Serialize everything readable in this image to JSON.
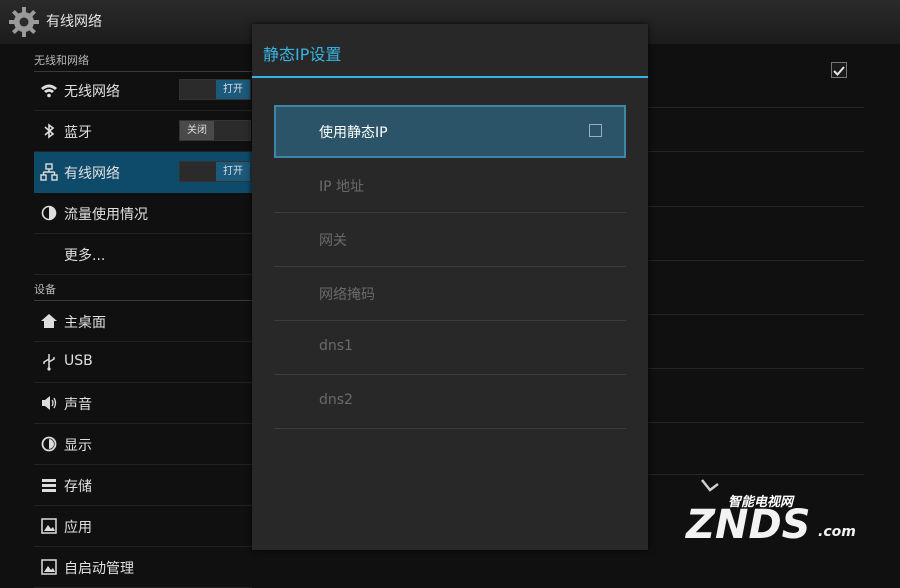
{
  "actionbar": {
    "title": "有线网络",
    "icon": "gear-icon"
  },
  "sections": [
    {
      "label": "无线和网络"
    },
    {
      "label": "设备"
    }
  ],
  "menu": [
    {
      "label": "无线网络",
      "icon": "wifi-icon",
      "toggle": "打开",
      "toggle_state": "on"
    },
    {
      "label": "蓝牙",
      "icon": "bluetooth-icon",
      "toggle": "关闭",
      "toggle_state": "off"
    },
    {
      "label": "有线网络",
      "icon": "ethernet-icon",
      "toggle": "打开",
      "toggle_state": "on",
      "selected": true
    },
    {
      "label": "流量使用情况",
      "icon": "data-usage-icon"
    },
    {
      "label": "更多...",
      "icon": ""
    },
    {
      "label": "主桌面",
      "icon": "home-icon"
    },
    {
      "label": "USB",
      "icon": "usb-icon"
    },
    {
      "label": "声音",
      "icon": "speaker-icon"
    },
    {
      "label": "显示",
      "icon": "display-icon"
    },
    {
      "label": "存储",
      "icon": "storage-icon"
    },
    {
      "label": "应用",
      "icon": "apps-icon"
    },
    {
      "label": "自启动管理",
      "icon": "autostart-icon"
    }
  ],
  "dialog": {
    "title": "静态IP设置",
    "items": [
      {
        "label": "使用静态IP",
        "checkbox": true,
        "checked": false,
        "focused": true
      },
      {
        "label": "IP 地址"
      },
      {
        "label": "网关"
      },
      {
        "label": "网络掩码"
      },
      {
        "label": "dns1"
      },
      {
        "label": "dns2"
      }
    ]
  },
  "watermark": {
    "text_top": "智能电视网",
    "text_main": "ZNDS",
    "text_suffix": ".com"
  },
  "colors": {
    "accent": "#35b5e5",
    "selected": "#0e4a6a",
    "dialog_bg": "#282828"
  }
}
